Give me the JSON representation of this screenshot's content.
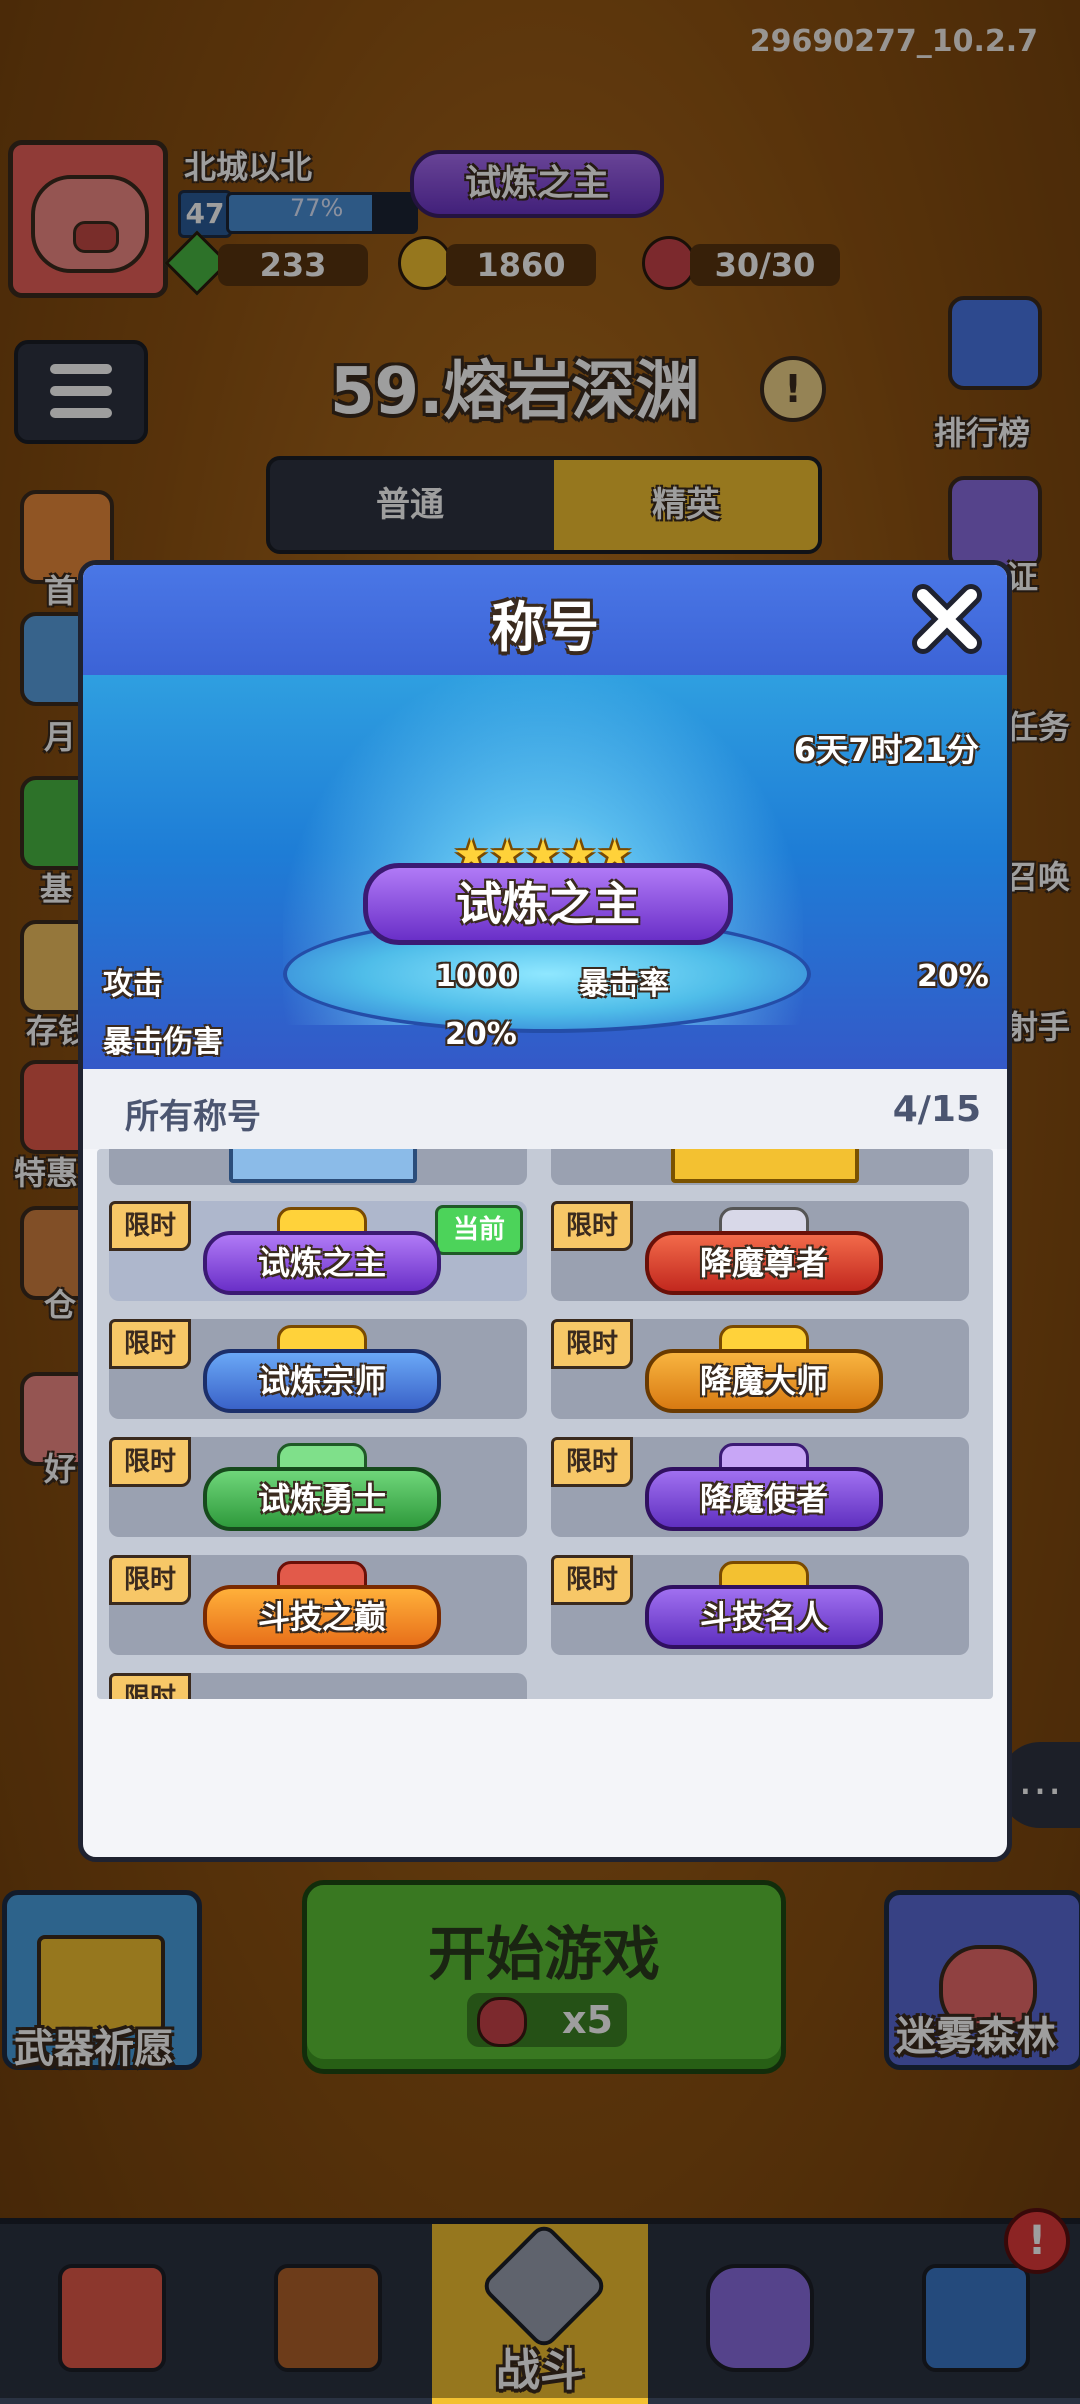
{
  "app": {
    "version": "29690277_10.2.7"
  },
  "player": {
    "name": "北城以北",
    "level": "47",
    "xp_percent_label": "77%",
    "xp_fraction": 0.77,
    "title_badge": "试炼之主"
  },
  "resources": {
    "gems": "233",
    "coins": "1860",
    "stamina": "30/30"
  },
  "stage": {
    "title": "59.熔岩深渊",
    "modes": {
      "normal": "普通",
      "elite": "精英"
    }
  },
  "side_menu": {
    "left": [
      "首",
      "月",
      "基",
      "存钱",
      "特惠",
      "仓",
      "好"
    ],
    "right": [
      "排行榜",
      "证",
      "任务",
      "召唤",
      "射手"
    ]
  },
  "modal": {
    "title": "称号",
    "timer": "6天7时21分",
    "selected_title": "试炼之主",
    "stats": {
      "attack_label": "攻击",
      "attack_value": "1000",
      "crit_rate_label": "暴击率",
      "crit_rate_value": "20%",
      "crit_damage_label": "暴击伤害",
      "crit_damage_value": "20%"
    },
    "list_title": "所有称号",
    "list_count": "4/15",
    "limited_tag": "限时",
    "current_tag": "当前",
    "titles": [
      "试炼之主",
      "降魔尊者",
      "试炼宗师",
      "降魔大师",
      "试炼勇士",
      "降魔使者",
      "斗技之巅",
      "斗技名人"
    ]
  },
  "bottom": {
    "left_card": "武器祈愿",
    "start_label": "开始游戏",
    "start_cost": "x5",
    "right_card": "迷雾森林",
    "nav_battle": "战斗"
  },
  "colors": {
    "accent_yellow": "#f3c131",
    "start_green": "#5cc236",
    "modal_blue": "#3c63d6",
    "limited_tag": "#f7c767",
    "current_tag": "#4cd35a"
  }
}
